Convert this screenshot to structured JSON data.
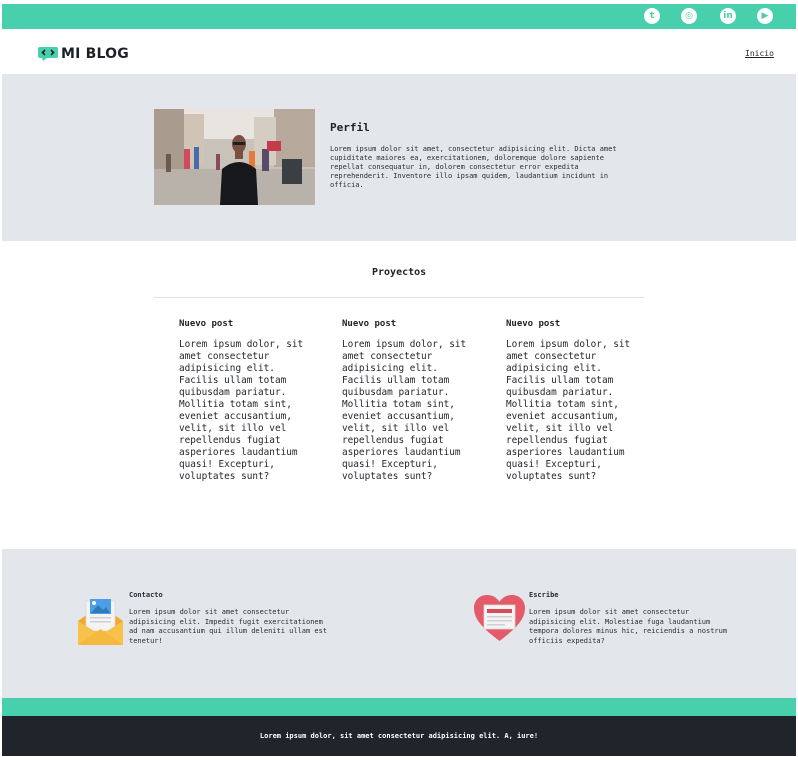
{
  "social": {
    "icons": [
      "tumblr-icon",
      "instagram-icon",
      "linkedin-icon",
      "youtube-icon"
    ],
    "tumblr_glyph": "t",
    "instagram_glyph": "◎",
    "linkedin_glyph": "in",
    "youtube_glyph": "▶"
  },
  "header": {
    "logo_text": "MI BLOG",
    "nav": {
      "inicio": "Inicio"
    }
  },
  "perfil": {
    "title": "Perfil",
    "text": "Lorem ipsum dolor sit amet, consectetur adipisicing elit. Dicta amet cupiditate maiores ea, exercitationem, doloremque dolore sapiente repellat consequatur in, dolorem consectetur error expedita reprehenderit. Inventore illo ipsam quidem, laudantium incidunt in officia."
  },
  "proyectos": {
    "title": "Proyectos",
    "posts": [
      {
        "title": "Nuevo post",
        "body": "Lorem ipsum dolor, sit amet consectetur adipisicing elit. Facilis ullam totam quibusdam pariatur. Mollitia totam sint, eveniet accusantium, velit, sit illo vel repellendus fugiat asperiores laudantium quasi! Excepturi, voluptates sunt?"
      },
      {
        "title": "Nuevo post",
        "body": "Lorem ipsum dolor, sit amet consectetur adipisicing elit. Facilis ullam totam quibusdam pariatur. Mollitia totam sint, eveniet accusantium, velit, sit illo vel repellendus fugiat asperiores laudantium quasi! Excepturi, voluptates sunt?"
      },
      {
        "title": "Nuevo post",
        "body": "Lorem ipsum dolor, sit amet consectetur adipisicing elit. Facilis ullam totam quibusdam pariatur. Mollitia totam sint, eveniet accusantium, velit, sit illo vel repellendus fugiat asperiores laudantium quasi! Excepturi, voluptates sunt?"
      }
    ]
  },
  "contact": {
    "left": {
      "title": "Contacto",
      "text": "Lorem ipsum dolor sit amet consectetur adipisicing elit. Impedit fugit exercitationem ad nam accusantium qui illum deleniti ullam est tenetur!"
    },
    "right": {
      "title": "Escribe",
      "text": "Lorem ipsum dolor sit amet consectetur adipisicing elit. Molestiae fuga laudantium tempora dolores minus hic, reiciendis a nostrum officiis expedita?"
    }
  },
  "footer": {
    "text": "Lorem ipsum dolor, sit amet consectetur adipisicing elit. A, iure!"
  },
  "colors": {
    "accent": "#48d0ac",
    "section_bg": "#e3e6ea",
    "footer_dark": "#20242b"
  }
}
